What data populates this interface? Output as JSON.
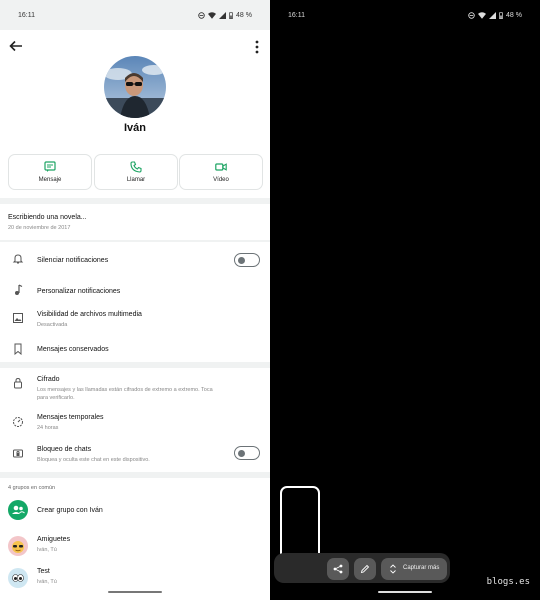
{
  "status": {
    "time": "16:11",
    "battery": "48 %"
  },
  "contact": {
    "name": "Iván",
    "actions": [
      "Mensaje",
      "Llamar",
      "Vídeo"
    ],
    "about": {
      "text": "Escribiendo una novela...",
      "date": "20 de noviembre de 2017"
    }
  },
  "settings": {
    "mute": "Silenciar notificaciones",
    "custom": "Personalizar notificaciones",
    "media_title": "Visibilidad de archivos multimedia",
    "media_sub": "Desactivada",
    "kept": "Mensajes conservados",
    "enc_title": "Cifrado",
    "enc_sub1": "Los mensajes y las llamadas están cifrados de extremo a extremo. Toca",
    "enc_sub2": "para verificarlo.",
    "temp_title": "Mensajes temporales",
    "temp_sub": "24 horas",
    "lock_title": "Bloqueo de chats",
    "lock_sub": "Bloquea y oculta este chat en este dispositivo."
  },
  "groups": {
    "title": "4 grupos en común",
    "create": "Crear grupo con Iván",
    "items": [
      {
        "name": "Amiguetes",
        "members": "Iván, Tú"
      },
      {
        "name": "Test",
        "members": "Iván, Tú"
      }
    ]
  },
  "screenshot_tools": {
    "capture_more": "Capturar más"
  },
  "watermark": "blogs.es",
  "colors": {
    "accent": "#1da463",
    "group_green": "#14a867"
  }
}
